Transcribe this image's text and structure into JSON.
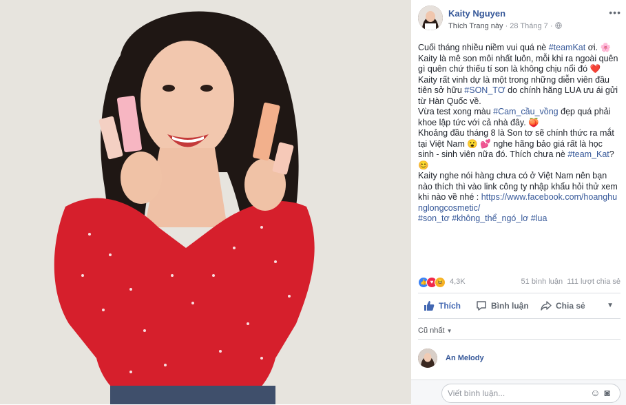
{
  "post": {
    "author": "Kaity Nguyen",
    "like_page": "Thích Trang này",
    "separator": "·",
    "date": "28 Tháng 7",
    "more_dots": "•••",
    "globe_icon": "globe-icon"
  },
  "body": {
    "l1a": "Cuối tháng nhiều niềm vui quá nè ",
    "l1tag": "#teamKat",
    "l1b": " ơi. 🌸",
    "l2": "Kaity là mê son môi nhất luôn, mỗi khi ra ngoài quên gì quên chứ thiếu tí son là không chịu nổi đó ❤️",
    "l3a": "Kaity rất vinh dự là một trong những diễn viên đầu tiên sở hữu ",
    "l3tag": "#SON_TƠ",
    "l3b": " do chính hãng LUA ưu ái gửi từ Hàn Quốc về.",
    "l4a": "Vừa test xong màu ",
    "l4tag": "#Cam_cầu_vồng",
    "l4b": " đẹp quá phải khoe lập tức với cả nhà đây. 🍑",
    "l5a": "Khoảng đầu tháng 8 là Son tơ sẽ chính thức ra mắt tại Việt Nam 😮 💕 nghe hãng bảo giá rất là học sinh - sinh viên nữa đó. Thích chưa nè ",
    "l5tag": "#team_Kat",
    "l5b": "? 😊",
    "l6a": "Kaity nghe nói hàng chưa có ở Việt Nam nên bạn nào thích thì vào link công ty nhập khẩu hỏi thử xem khi nào về nhé : ",
    "l6link": "https://www.facebook.com/hoanghunglongcosmetic/",
    "t1": "#son_tơ",
    "t2": "#không_thể_ngó_lơ",
    "t3": "#lua"
  },
  "stats": {
    "reactions_count": "4,3K",
    "comments": "51 bình luận",
    "shares": "111 lượt chia sẻ"
  },
  "actions": {
    "like": "Thích",
    "comment": "Bình luận",
    "share": "Chia sẻ"
  },
  "comments": {
    "sort_label": "Cũ nhất",
    "first_author": "An Melody"
  },
  "composer": {
    "placeholder": "Viết bình luận...",
    "emoji_icon": "emoji-icon",
    "camera_icon": "camera-icon"
  },
  "colors": {
    "link": "#365899",
    "like_blue": "#4267b2",
    "meta_gray": "#90949c",
    "dress_red": "#d61f2c"
  }
}
